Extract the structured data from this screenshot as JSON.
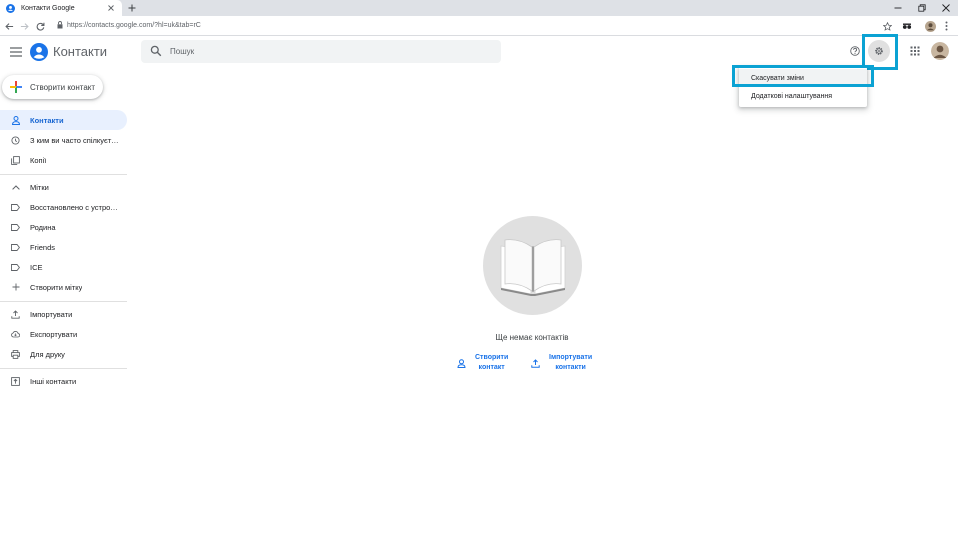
{
  "colors": {
    "google_blue": "#1a73e8",
    "nav_active_bg": "#e8f0fe",
    "annotation_highlight": "#0ba2d3"
  },
  "browser": {
    "tab_title": "Контакти Google",
    "tab_favicon": "google-contacts-icon",
    "url": "https://contacts.google.com/?hl=uk&tab=rC"
  },
  "app": {
    "name": "Контакти",
    "search_placeholder": "Пошук"
  },
  "sidebar": {
    "create_contact": "Створити контакт",
    "items": [
      {
        "label": "Контакти",
        "icon": "person-icon",
        "active": true
      },
      {
        "label": "З ким ви часто спілкуєтеся",
        "icon": "history-icon"
      },
      {
        "label": "Копії",
        "icon": "copy-icon"
      }
    ],
    "labels_header": "Мітки",
    "labels": [
      {
        "label": "Восстановлено с устройства",
        "icon": "label-icon"
      },
      {
        "label": "Родина",
        "icon": "label-icon"
      },
      {
        "label": "Friends",
        "icon": "label-icon"
      },
      {
        "label": "ICE",
        "icon": "label-icon"
      }
    ],
    "create_label": "Створити мітку",
    "tools": [
      {
        "label": "Імпортувати",
        "icon": "upload-icon"
      },
      {
        "label": "Експортувати",
        "icon": "cloud-download-icon"
      },
      {
        "label": "Для друку",
        "icon": "print-icon"
      }
    ],
    "other_contacts": "Інші контакти"
  },
  "empty_state": {
    "message": "Ще немає контактів",
    "create_line1": "Створити",
    "create_line2": "контакт",
    "import_line1": "Імпортувати",
    "import_line2": "контакти"
  },
  "settings_menu": {
    "items": [
      "Скасувати зміни",
      "Додаткові налаштування"
    ]
  }
}
